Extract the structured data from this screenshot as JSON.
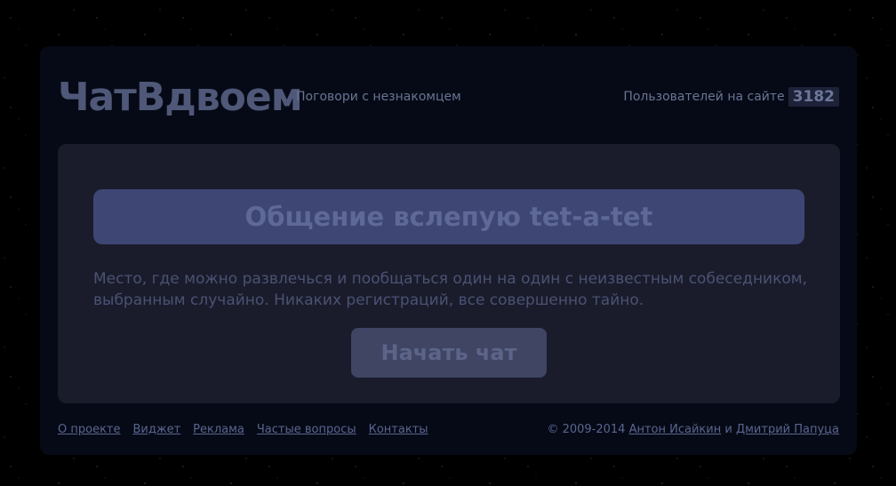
{
  "header": {
    "logo": "ЧатВдвоем",
    "tagline": "Поговори с незнакомцем",
    "users_label": "Пользователей на сайте",
    "users_count": "3182"
  },
  "main": {
    "banner": "Общение вслепую tet-a-tet",
    "description": "Место, где можно развлечься и пообщаться один на один с неизвестным собеседником, выбранным случайно. Никаких регистраций, все совершенно тайно.",
    "start_button": "Начать чат"
  },
  "footer": {
    "links": [
      "О проекте",
      "Виджет",
      "Реклама",
      "Частые вопросы",
      "Контакты"
    ],
    "copyright": "© 2009-2014",
    "author1": "Антон Исайкин",
    "conjunction": "и",
    "author2": "Дмитрий Папуца"
  },
  "colors": {
    "background": "#000000",
    "container": "#060a16",
    "panel": "#1a1c2c",
    "banner": "#3e4674",
    "button": "#3f4563",
    "link": "#5a6590"
  }
}
